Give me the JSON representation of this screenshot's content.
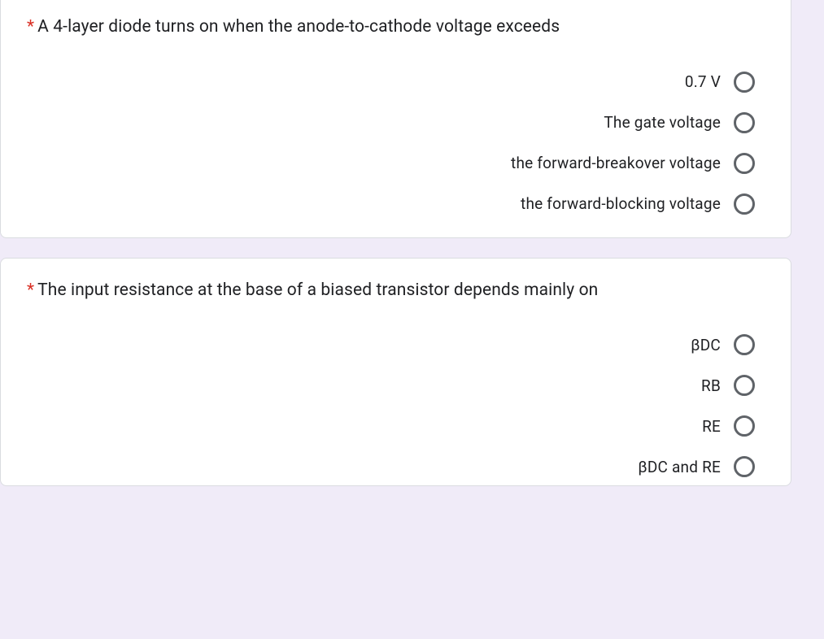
{
  "questions": [
    {
      "required_marker": "*",
      "text": "A 4-layer diode turns on when the anode-to-cathode voltage exceeds",
      "options": [
        "0.7 V",
        "The gate voltage",
        "the forward-breakover voltage",
        "the forward-blocking voltage"
      ]
    },
    {
      "required_marker": "*",
      "text": "The input resistance at the base of a biased transistor depends mainly on",
      "options": [
        "βDC",
        "RB",
        "RE",
        "βDC and RE"
      ]
    }
  ]
}
